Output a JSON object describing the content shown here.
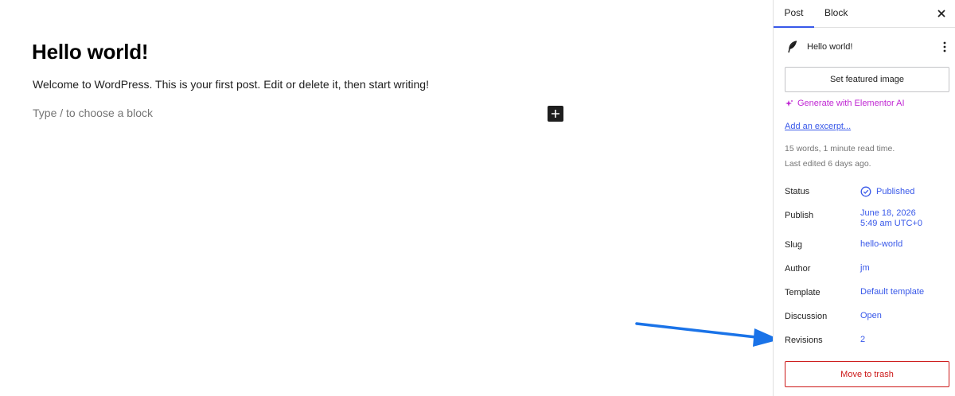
{
  "editor": {
    "title": "Hello world!",
    "paragraph": "Welcome to WordPress. This is your first post. Edit or delete it, then start writing!",
    "block_placeholder": "Type / to choose a block",
    "inserter_icon": "plus-icon"
  },
  "sidebar": {
    "tabs": [
      {
        "label": "Post",
        "active": true
      },
      {
        "label": "Block",
        "active": false
      }
    ],
    "close_icon": "close-icon",
    "post_name": "Hello world!",
    "post_icon": "feather-icon",
    "featured_image_button": "Set featured image",
    "elementor_ai_link": "Generate with Elementor AI",
    "excerpt_link": "Add an excerpt...",
    "word_count": "15 words, 1 minute read time.",
    "last_edited": "Last edited 6 days ago.",
    "rows": {
      "status": {
        "label": "Status",
        "value": "Published"
      },
      "publish": {
        "label": "Publish",
        "value_line1": "June 18, 2026",
        "value_line2": "5:49 am UTC+0"
      },
      "slug": {
        "label": "Slug",
        "value": "hello-world"
      },
      "author": {
        "label": "Author",
        "value": "jm"
      },
      "template": {
        "label": "Template",
        "value": "Default template"
      },
      "discussion": {
        "label": "Discussion",
        "value": "Open"
      },
      "revisions": {
        "label": "Revisions",
        "value": "2"
      }
    },
    "trash_button": "Move to trash"
  },
  "colors": {
    "accent": "#3858e9",
    "elementor": "#c026d3",
    "danger": "#cc1818",
    "annotation_arrow": "#1a73e8"
  }
}
